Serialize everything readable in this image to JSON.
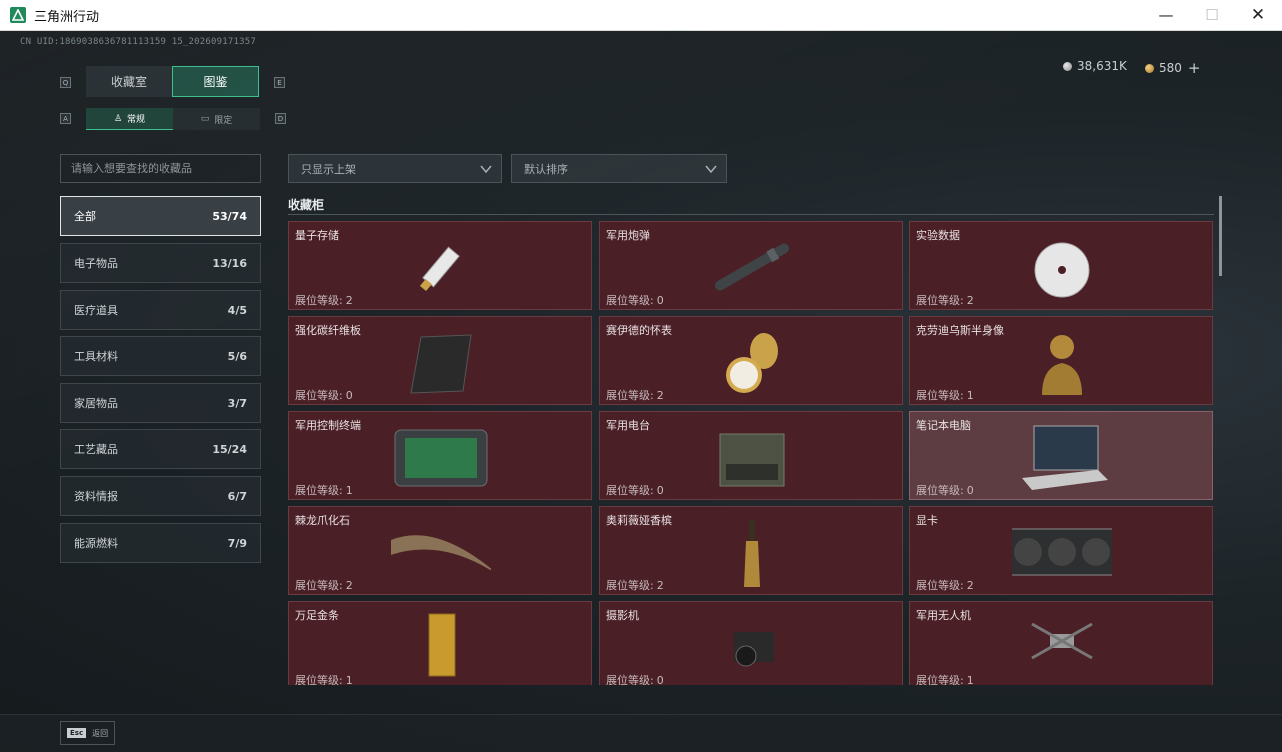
{
  "window": {
    "title": "三角洲行动",
    "minimize": "—",
    "maximize": "☐",
    "close": "✕"
  },
  "user": {
    "uid": "CN UID:1869038636781113159 15_202609171357"
  },
  "currency": {
    "silver": "38,631K",
    "gold": "580",
    "plus": "+"
  },
  "keyhints": {
    "q": "Q",
    "e": "E",
    "a": "A",
    "d": "D"
  },
  "tabs": [
    {
      "label": "收藏室"
    },
    {
      "label": "图鉴"
    }
  ],
  "subtabs": [
    {
      "label": "常规"
    },
    {
      "label": "限定"
    }
  ],
  "search": {
    "placeholder": "请输入想要查找的收藏品"
  },
  "filters": {
    "shelf": "只显示上架",
    "sort": "默认排序"
  },
  "categories": [
    {
      "label": "全部",
      "count": "53/74"
    },
    {
      "label": "电子物品",
      "count": "13/16"
    },
    {
      "label": "医疗道具",
      "count": "4/5"
    },
    {
      "label": "工具材料",
      "count": "5/6"
    },
    {
      "label": "家居物品",
      "count": "3/7"
    },
    {
      "label": "工艺藏品",
      "count": "15/24"
    },
    {
      "label": "资料情报",
      "count": "6/7"
    },
    {
      "label": "能源燃料",
      "count": "7/9"
    }
  ],
  "section": {
    "title": "收藏柜"
  },
  "level_label": "展位等级:",
  "items": [
    {
      "name": "量子存储",
      "level": "2",
      "icon": "usb-drive-icon"
    },
    {
      "name": "军用炮弹",
      "level": "0",
      "icon": "artillery-shell-icon"
    },
    {
      "name": "实验数据",
      "level": "2",
      "icon": "disc-icon"
    },
    {
      "name": "强化碳纤维板",
      "level": "0",
      "icon": "carbon-plate-icon"
    },
    {
      "name": "赛伊德的怀表",
      "level": "2",
      "icon": "pocket-watch-icon"
    },
    {
      "name": "克劳迪乌斯半身像",
      "level": "1",
      "icon": "bust-icon"
    },
    {
      "name": "军用控制终端",
      "level": "1",
      "icon": "control-terminal-icon"
    },
    {
      "name": "军用电台",
      "level": "0",
      "icon": "radio-icon"
    },
    {
      "name": "笔记本电脑",
      "level": "0",
      "icon": "laptop-icon"
    },
    {
      "name": "棘龙爪化石",
      "level": "2",
      "icon": "claw-fossil-icon"
    },
    {
      "name": "奥莉薇娅香槟",
      "level": "2",
      "icon": "champagne-icon"
    },
    {
      "name": "显卡",
      "level": "2",
      "icon": "graphics-card-icon"
    },
    {
      "name": "万足金条",
      "level": "1",
      "icon": "gold-bar-icon"
    },
    {
      "name": "摄影机",
      "level": "0",
      "icon": "camera-icon"
    },
    {
      "name": "军用无人机",
      "level": "1",
      "icon": "drone-icon"
    }
  ],
  "bottom": {
    "esc_key": "Esc",
    "esc_label": "返回"
  },
  "colors": {
    "accent": "#3fbf8f",
    "card_bg": "#4a1f26",
    "card_highlight": "#5d3c42"
  }
}
